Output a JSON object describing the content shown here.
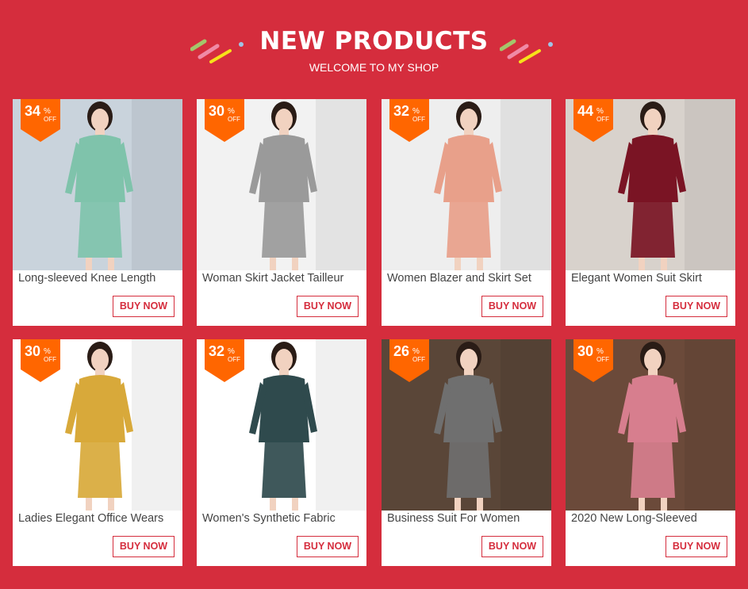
{
  "header": {
    "title": "NEW PRODUCTS",
    "subtitle": "WELCOME TO MY SHOP"
  },
  "colors": {
    "background": "#d52d3d",
    "badge": "#ff6600",
    "button_border": "#d52d3d"
  },
  "products": [
    {
      "discount": "34",
      "pct": "%",
      "off": "OFF",
      "name": "Long-sleeved Knee Length",
      "button": "BUY NOW",
      "suit_color": "#7fc3ab",
      "bg_color": "#c9d3dc"
    },
    {
      "discount": "30",
      "pct": "%",
      "off": "OFF",
      "name": "Woman Skirt Jacket Tailleur",
      "button": "BUY NOW",
      "suit_color": "#9a9a9a",
      "bg_color": "#f2f2f2"
    },
    {
      "discount": "32",
      "pct": "%",
      "off": "OFF",
      "name": "Women Blazer and Skirt Set",
      "button": "BUY NOW",
      "suit_color": "#e8a08a",
      "bg_color": "#eeeeee"
    },
    {
      "discount": "44",
      "pct": "%",
      "off": "OFF",
      "name": "Elegant Women Suit Skirt",
      "button": "BUY NOW",
      "suit_color": "#7a1424",
      "bg_color": "#d8d2cc"
    },
    {
      "discount": "30",
      "pct": "%",
      "off": "OFF",
      "name": "Ladies Elegant Office Wears",
      "button": "BUY NOW",
      "suit_color": "#d8a93a",
      "bg_color": "#ffffff"
    },
    {
      "discount": "32",
      "pct": "%",
      "off": "OFF",
      "name": "Women's Synthetic Fabric",
      "button": "BUY NOW",
      "suit_color": "#2f4a4d",
      "bg_color": "#ffffff"
    },
    {
      "discount": "26",
      "pct": "%",
      "off": "OFF",
      "name": "Business Suit For Women",
      "button": "BUY NOW",
      "suit_color": "#6f6f6f",
      "bg_color": "#5a4638"
    },
    {
      "discount": "30",
      "pct": "%",
      "off": "OFF",
      "name": "2020 New Long-Sleeved",
      "button": "BUY NOW",
      "suit_color": "#d77e8e",
      "bg_color": "#6b4a3a"
    }
  ]
}
